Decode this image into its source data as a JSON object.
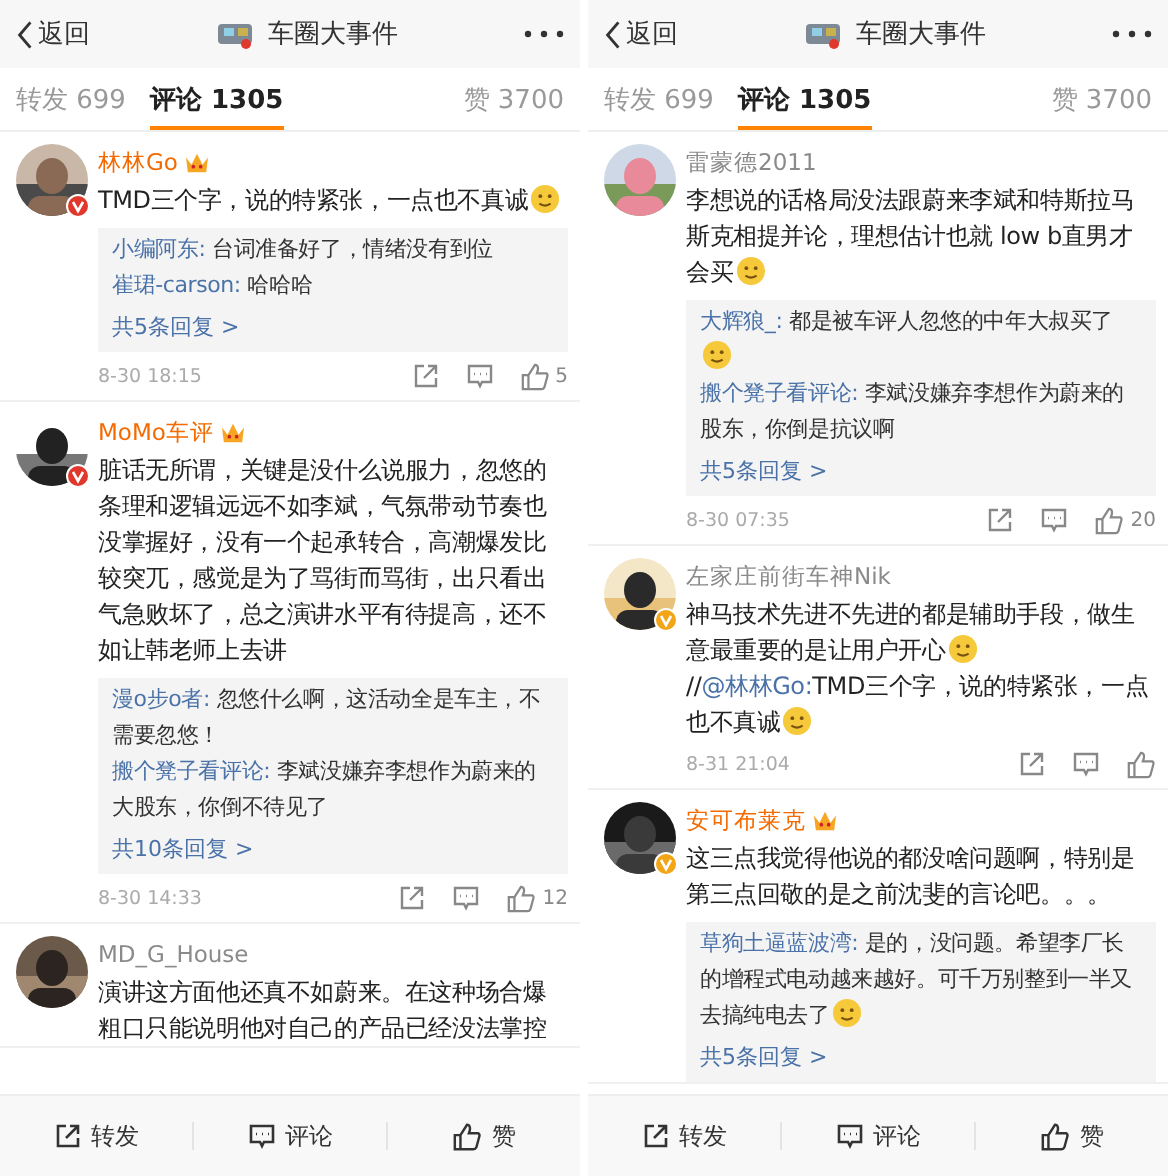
{
  "screens": [
    {
      "header": {
        "back": "返回",
        "title": "车圈大事件"
      },
      "tabs": [
        {
          "label": "转发 699",
          "selected": false
        },
        {
          "label": "评论 1305",
          "selected": true
        },
        {
          "label": "赞 3700",
          "selected": false
        }
      ],
      "comments": [
        {
          "name": "林林Go",
          "vip": true,
          "badge": {
            "color": "#e0382d"
          },
          "segments": [
            {
              "kind": "text",
              "text": "TMD三个字，说的特紧张，一点也不真诚"
            },
            {
              "kind": "emoji"
            }
          ],
          "replies": [
            {
              "author": "小编阿东:",
              "text": "台词准备好了，情绪没有到位"
            },
            {
              "author": "崔珺-carson:",
              "text": "哈哈哈"
            }
          ],
          "more": "共5条回复 >",
          "time": "8-30 18:15",
          "likes": "5"
        },
        {
          "name": "MoMo车评",
          "vip": true,
          "badge": {
            "color": "#e0382d"
          },
          "segments": [
            {
              "kind": "text",
              "text": "脏话无所谓，关键是没什么说服力，忽悠的条理和逻辑远远不如李斌，气氛带动节奏也没掌握好，没有一个起承转合，高潮爆发比较突兀，感觉是为了骂街而骂街，出只看出气急败坏了，总之演讲水平有待提高，还不如让韩老师上去讲"
            }
          ],
          "replies": [
            {
              "author": "漫o步o者:",
              "text": "忽悠什么啊，这活动全是车主，不需要忽悠！"
            },
            {
              "author": "搬个凳子看评论:",
              "text": "李斌没嫌弃李想作为蔚来的大股东，你倒不待见了"
            }
          ],
          "more": "共10条回复 >",
          "time": "8-30 14:33",
          "likes": "12"
        },
        {
          "name": "MD_G_House",
          "vip": false,
          "segments": [
            {
              "kind": "text",
              "text": "演讲这方面他还真不如蔚来。在这种场合爆粗口只能说明他对自己的产品已经没法掌控"
            }
          ]
        }
      ],
      "actions": [
        "转发",
        "评论",
        "赞"
      ]
    },
    {
      "header": {
        "back": "返回",
        "title": "车圈大事件"
      },
      "tabs": [
        {
          "label": "转发 699",
          "selected": false
        },
        {
          "label": "评论 1305",
          "selected": true
        },
        {
          "label": "赞 3700",
          "selected": false
        }
      ],
      "comments": [
        {
          "name": "雷蒙德2011",
          "vip": false,
          "segments": [
            {
              "kind": "text",
              "text": "李想说的话格局没法跟蔚来李斌和特斯拉马斯克相提并论，理想估计也就 low b直男才会买"
            },
            {
              "kind": "emoji"
            }
          ],
          "replies": [
            {
              "author": "大辉狼_:",
              "text": "都是被车评人忽悠的中年大叔买了",
              "emoji": true
            },
            {
              "author": "搬个凳子看评论:",
              "text": "李斌没嫌弃李想作为蔚来的股东，你倒是抗议啊"
            }
          ],
          "more": "共5条回复 >",
          "time": "8-30 07:35",
          "likes": "20"
        },
        {
          "name": "左家庄前街车神Nik",
          "vip": false,
          "badge": {
            "color": "#f2a516"
          },
          "segments": [
            {
              "kind": "text",
              "text": "神马技术先进不先进的都是辅助手段，做生意最重要的是让用户开心"
            },
            {
              "kind": "emoji"
            },
            {
              "kind": "text",
              "text": "//"
            },
            {
              "kind": "mention",
              "text": "@林林Go:"
            },
            {
              "kind": "text",
              "text": "TMD三个字，说的特紧张，一点也不真诚"
            },
            {
              "kind": "emoji"
            }
          ],
          "time": "8-31 21:04"
        },
        {
          "name": "安可布莱克",
          "vip": true,
          "badge": {
            "color": "#f2a516"
          },
          "segments": [
            {
              "kind": "text",
              "text": "这三点我觉得他说的都没啥问题啊，特别是第三点回敬的是之前沈斐的言论吧。。。"
            }
          ],
          "replies": [
            {
              "author": "草狗土逼蓝波湾:",
              "text": "是的，没问题。希望李厂长的增程式电动越来越好。可千万别整到一半又去搞纯电去了",
              "emoji": true
            }
          ],
          "more": "共5条回复 >"
        }
      ],
      "actions": [
        "转发",
        "评论",
        "赞"
      ]
    }
  ]
}
